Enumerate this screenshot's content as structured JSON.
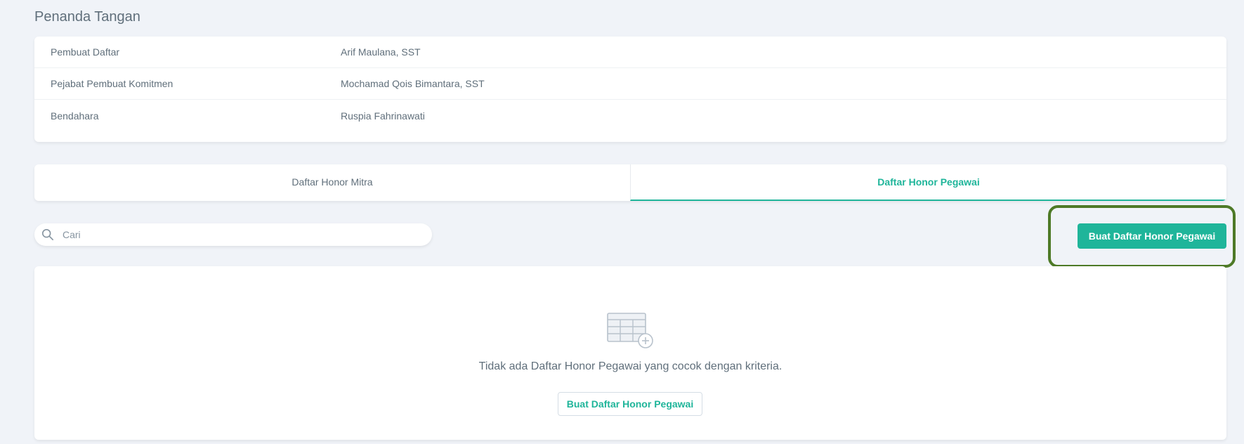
{
  "section": {
    "title": "Penanda Tangan"
  },
  "signers": [
    {
      "label": "Pembuat Daftar",
      "value": "Arif Maulana, SST"
    },
    {
      "label": "Pejabat Pembuat Komitmen",
      "value": "Mochamad Qois Bimantara, SST"
    },
    {
      "label": "Bendahara",
      "value": "Ruspia Fahrinawati"
    }
  ],
  "tabs": [
    {
      "label": "Daftar Honor Mitra",
      "active": false
    },
    {
      "label": "Daftar Honor Pegawai",
      "active": true
    }
  ],
  "search": {
    "placeholder": "Cari",
    "value": "",
    "icon": "search-icon"
  },
  "toolbar": {
    "create_label": "Buat Daftar Honor Pegawai"
  },
  "empty_state": {
    "icon": "table-add-icon",
    "message": "Tidak ada Daftar Honor Pegawai yang cocok dengan kriteria.",
    "button_label": "Buat Daftar Honor Pegawai"
  },
  "colors": {
    "accent": "#1fb59a",
    "highlight": "#4e7a27",
    "background": "#f0f3f8",
    "text": "#606f7b"
  }
}
